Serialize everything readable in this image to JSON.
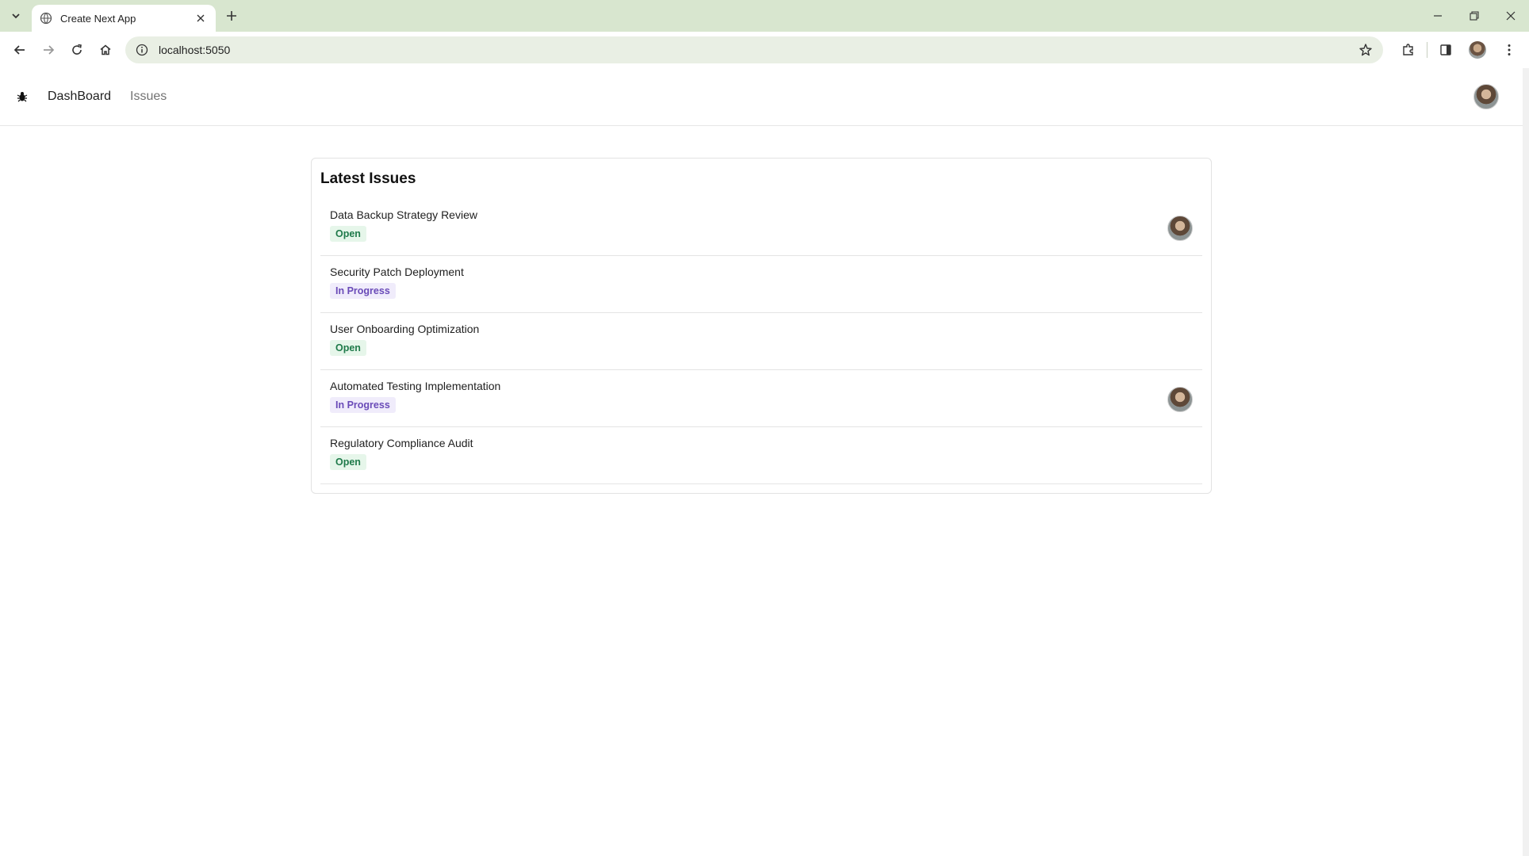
{
  "browser": {
    "tab_title": "Create Next App",
    "url": "localhost:5050"
  },
  "nav": {
    "links": [
      {
        "label": "DashBoard"
      },
      {
        "label": "Issues"
      }
    ]
  },
  "latest": {
    "title": "Latest Issues",
    "issues": [
      {
        "title": "Data Backup Strategy Review",
        "status": "Open",
        "assigned": true
      },
      {
        "title": "Security Patch Deployment",
        "status": "In Progress",
        "assigned": false
      },
      {
        "title": "User Onboarding Optimization",
        "status": "Open",
        "assigned": false
      },
      {
        "title": "Automated Testing Implementation",
        "status": "In Progress",
        "assigned": true
      },
      {
        "title": "Regulatory Compliance Audit",
        "status": "Open",
        "assigned": false
      }
    ]
  },
  "colors": {
    "tabstrip": "#d8e6cf",
    "open_badge_bg": "#e6f6ea",
    "open_badge_text": "#1f7a4a",
    "progress_badge_bg": "#f0ecfb",
    "progress_badge_text": "#6a4bb8"
  }
}
